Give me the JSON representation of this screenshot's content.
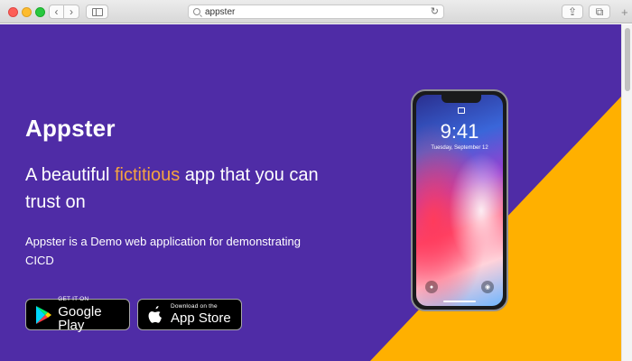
{
  "browser": {
    "address": "appster",
    "back_glyph": "‹",
    "forward_glyph": "›",
    "reload_glyph": "↻",
    "share_glyph": "⇪",
    "tabs_glyph": "⧉",
    "new_tab_glyph": "+"
  },
  "hero": {
    "brand": "Appster",
    "headline_before": "A beautiful ",
    "headline_accent": "fictitious",
    "headline_after": " app that you can trust on",
    "description": "Appster is a Demo web application for demonstrating CICD"
  },
  "badges": {
    "google_small": "GET IT ON",
    "google_large": "Google Play",
    "apple_small": "Download on the",
    "apple_large": "App Store"
  },
  "phone": {
    "time": "9:41",
    "date": "Tuesday, September 12"
  },
  "colors": {
    "background": "#4f2ca6",
    "accent": "#f4a340",
    "triangle": "#ffb000"
  },
  "icons": [
    "search-icon",
    "reload-icon",
    "share-icon",
    "tabs-icon",
    "sidebar-icon",
    "google-play-icon",
    "apple-icon",
    "flashlight-icon",
    "camera-icon"
  ]
}
